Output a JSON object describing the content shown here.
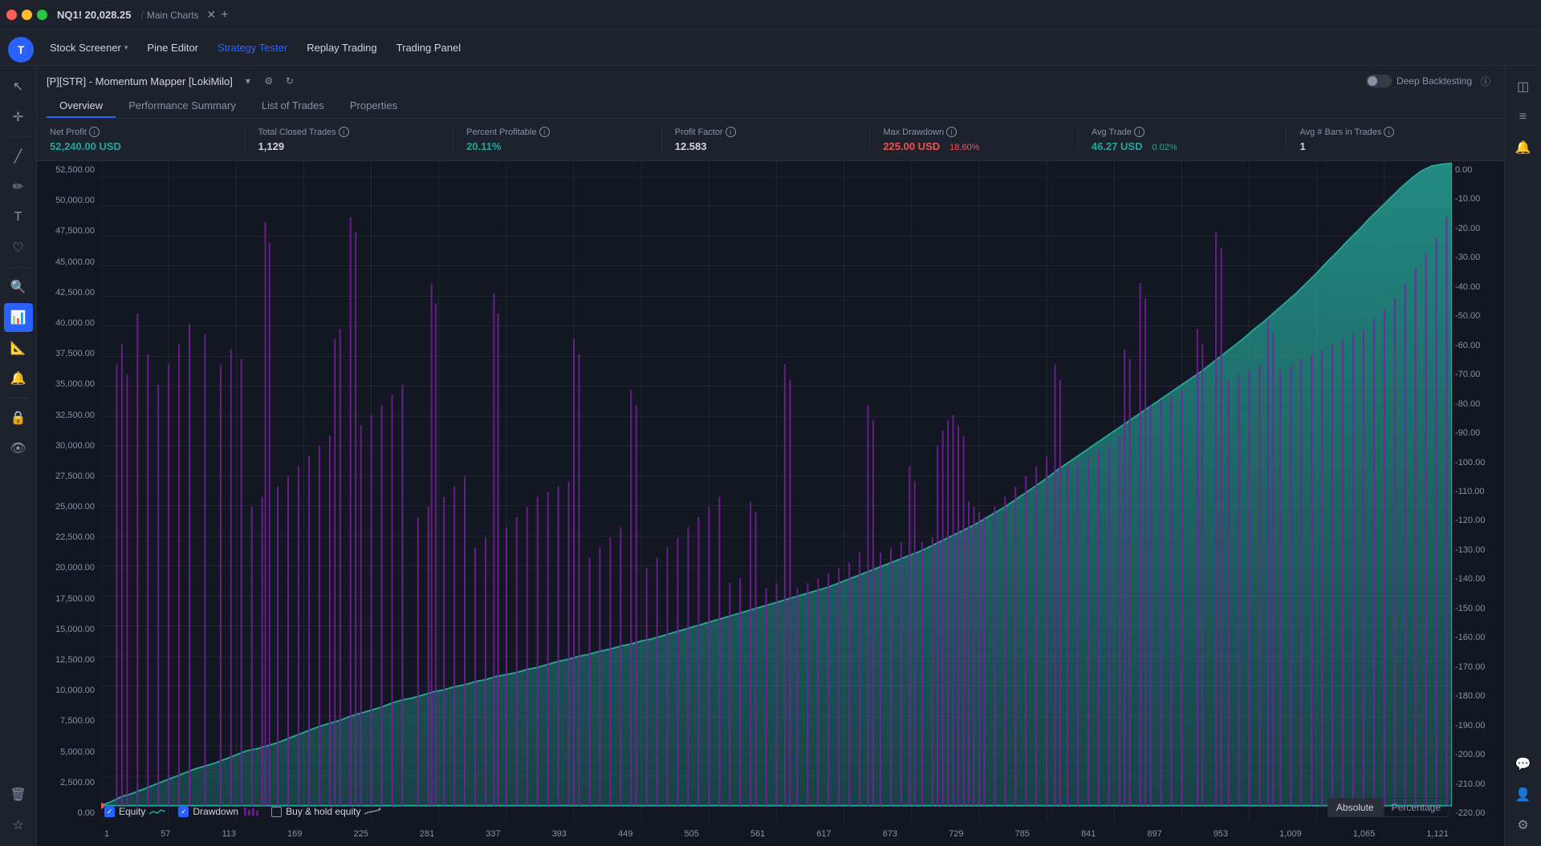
{
  "titlebar": {
    "symbol": "NQ1! 20,028.25",
    "separator": "/",
    "chart_name": "Main Charts",
    "close_label": "✕",
    "plus_label": "+"
  },
  "topnav": {
    "logo": "T",
    "items": [
      {
        "id": "stock-screener",
        "label": "Stock Screener",
        "has_chevron": true,
        "active": false
      },
      {
        "id": "pine-editor",
        "label": "Pine Editor",
        "has_chevron": false,
        "active": false
      },
      {
        "id": "strategy-tester",
        "label": "Strategy Tester",
        "has_chevron": false,
        "active": true
      },
      {
        "id": "replay-trading",
        "label": "Replay Trading",
        "has_chevron": false,
        "active": false
      },
      {
        "id": "trading-panel",
        "label": "Trading Panel",
        "has_chevron": false,
        "active": false
      }
    ]
  },
  "left_sidebar": {
    "icons": [
      {
        "id": "cursor",
        "symbol": "↖",
        "active": false
      },
      {
        "id": "crosshair",
        "symbol": "✛",
        "active": false
      },
      {
        "id": "line-tool",
        "symbol": "╱",
        "active": false
      },
      {
        "id": "brush",
        "symbol": "✏",
        "active": false
      },
      {
        "id": "text",
        "symbol": "T",
        "active": false
      },
      {
        "id": "favorites",
        "symbol": "♡",
        "active": false
      },
      {
        "id": "patterns",
        "symbol": "⟨⟩",
        "active": false
      },
      {
        "id": "search",
        "symbol": "🔍",
        "active": false
      },
      {
        "id": "strategy",
        "symbol": "📊",
        "active": true
      },
      {
        "id": "measure",
        "symbol": "📐",
        "active": false
      },
      {
        "id": "alert",
        "symbol": "🔔",
        "active": false
      },
      {
        "id": "lock",
        "symbol": "🔒",
        "active": false
      },
      {
        "id": "eye",
        "symbol": "👁",
        "active": false
      },
      {
        "id": "trash",
        "symbol": "🗑",
        "active": false
      }
    ]
  },
  "right_sidebar": {
    "icons": [
      {
        "id": "chart-type",
        "symbol": "◫"
      },
      {
        "id": "indicators",
        "symbol": "⌇"
      },
      {
        "id": "alert-right",
        "symbol": "🔔"
      },
      {
        "id": "chat",
        "symbol": "💬"
      },
      {
        "id": "community",
        "symbol": "👤"
      }
    ]
  },
  "strategy": {
    "title": "[P][STR] - Momentum Mapper [LokiMilo]",
    "has_settings": true,
    "has_refresh": true,
    "deep_backtesting_label": "Deep Backtesting"
  },
  "tabs": [
    {
      "id": "overview",
      "label": "Overview",
      "active": true
    },
    {
      "id": "performance-summary",
      "label": "Performance Summary",
      "active": false
    },
    {
      "id": "list-of-trades",
      "label": "List of Trades",
      "active": false
    },
    {
      "id": "properties",
      "label": "Properties",
      "active": false
    }
  ],
  "stats": [
    {
      "id": "net-profit",
      "label": "Net Profit",
      "value": "52,240.00 USD",
      "value_class": "green",
      "sub": null
    },
    {
      "id": "total-closed-trades",
      "label": "Total Closed Trades",
      "value": "1,129",
      "value_class": "normal",
      "sub": null
    },
    {
      "id": "percent-profitable",
      "label": "Percent Profitable",
      "value": "20.11%",
      "value_class": "green",
      "sub": null
    },
    {
      "id": "profit-factor",
      "label": "Profit Factor",
      "value": "12.583",
      "value_class": "normal",
      "sub": null
    },
    {
      "id": "max-drawdown",
      "label": "Max Drawdown",
      "value": "225.00 USD",
      "value_class": "red",
      "sub": "18.60%",
      "sub_class": "red"
    },
    {
      "id": "avg-trade",
      "label": "Avg Trade",
      "value": "46.27 USD",
      "value_class": "green",
      "sub": "0.02%",
      "sub_class": "green"
    },
    {
      "id": "avg-bars",
      "label": "Avg # Bars in Trades",
      "value": "1",
      "value_class": "normal",
      "sub": null
    }
  ],
  "chart": {
    "y_axis_left": [
      "52,500.00",
      "50,000.00",
      "47,500.00",
      "45,000.00",
      "42,500.00",
      "40,000.00",
      "37,500.00",
      "35,000.00",
      "32,500.00",
      "30,000.00",
      "27,500.00",
      "25,000.00",
      "22,500.00",
      "20,000.00",
      "17,500.00",
      "15,000.00",
      "12,500.00",
      "10,000.00",
      "7,500.00",
      "5,000.00",
      "2,500.00",
      "0.00"
    ],
    "y_axis_right": [
      "0.00",
      "-10.00",
      "-20.00",
      "-30.00",
      "-40.00",
      "-50.00",
      "-60.00",
      "-70.00",
      "-80.00",
      "-90.00",
      "-100.00",
      "-110.00",
      "-120.00",
      "-130.00",
      "-140.00",
      "-150.00",
      "-160.00",
      "-170.00",
      "-180.00",
      "-190.00",
      "-200.00",
      "-210.00",
      "-220.00"
    ],
    "x_axis": [
      "1",
      "57",
      "113",
      "169",
      "225",
      "281",
      "337",
      "393",
      "449",
      "505",
      "561",
      "617",
      "673",
      "729",
      "785",
      "841",
      "897",
      "953",
      "1,009",
      "1,065",
      "1,121"
    ]
  },
  "legend": {
    "equity": {
      "label": "Equity",
      "checked": true,
      "color": "#26a69a"
    },
    "drawdown": {
      "label": "Drawdown",
      "checked": true,
      "color": "#7b1fa2"
    },
    "buy_hold": {
      "label": "Buy & hold equity",
      "checked": false,
      "color": "#8892a4"
    }
  },
  "bottom_buttons": [
    {
      "id": "absolute",
      "label": "Absolute",
      "active": true
    },
    {
      "id": "percentage",
      "label": "Percentage",
      "active": false
    }
  ]
}
